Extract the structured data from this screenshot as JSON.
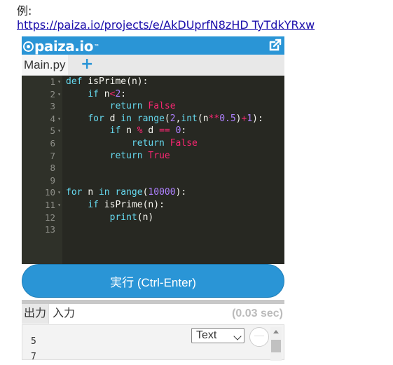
{
  "intro": {
    "example_label": "例:",
    "link": "https://paiza.io/projects/e/AkDUprfN8zHD TyTdkYRxw"
  },
  "widget": {
    "logo_text": "paiza.io",
    "logo_tm": "™",
    "file_tab": "Main.py",
    "add_tab": "+",
    "run_button": "実行 (Ctrl-Enter)",
    "output_tab": "出力",
    "input_tab": "入力",
    "elapsed": "(0.03 sec)",
    "format_select": "Text",
    "output_lines": [
      "5",
      "7"
    ]
  },
  "code": {
    "line_numbers": [
      "1",
      "2",
      "3",
      "4",
      "5",
      "6",
      "7",
      "8",
      "9",
      "10",
      "11",
      "12",
      "13"
    ],
    "folds": [
      1,
      2,
      4,
      5,
      10,
      11
    ],
    "lines": [
      "def isPrime(n):",
      "    if n<2:",
      "        return False",
      "    for d in range(2,int(n**0.5)+1):",
      "        if n % d == 0:",
      "            return False",
      "        return True",
      "",
      "",
      "for n in range(10000):",
      "    if isPrime(n):",
      "        print(n)",
      ""
    ]
  },
  "colors": {
    "brand": "#2a95d6",
    "editor_bg": "#272822",
    "keyword": "#66d9ef",
    "operator": "#f92672",
    "number": "#ae81ff"
  },
  "icons": {
    "logo": "paiza-logo-icon",
    "external": "external-link-icon",
    "toggle": "wrap-toggle-icon"
  }
}
